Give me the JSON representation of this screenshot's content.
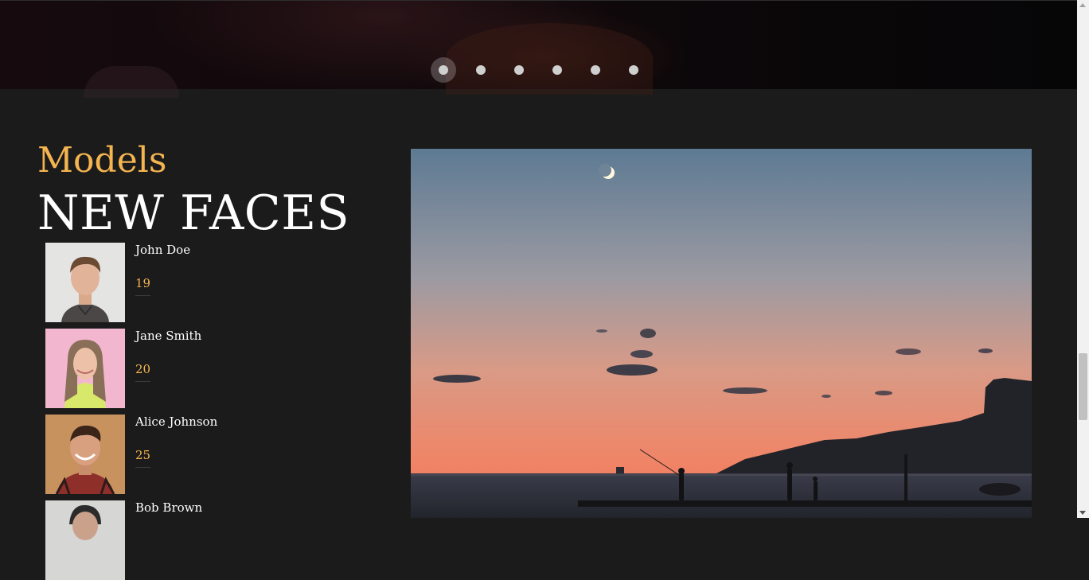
{
  "carousel": {
    "slide_count": 6,
    "active_index": 0
  },
  "section": {
    "subtitle": "Models",
    "title": "NEW FACES"
  },
  "models": [
    {
      "name": "John Doe",
      "age": "19"
    },
    {
      "name": "Jane Smith",
      "age": "20"
    },
    {
      "name": "Alice Johnson",
      "age": "25"
    },
    {
      "name": "Bob Brown",
      "age": ""
    }
  ],
  "colors": {
    "accent": "#f4b450",
    "background": "#1b1b1b",
    "text": "#ffffff"
  }
}
